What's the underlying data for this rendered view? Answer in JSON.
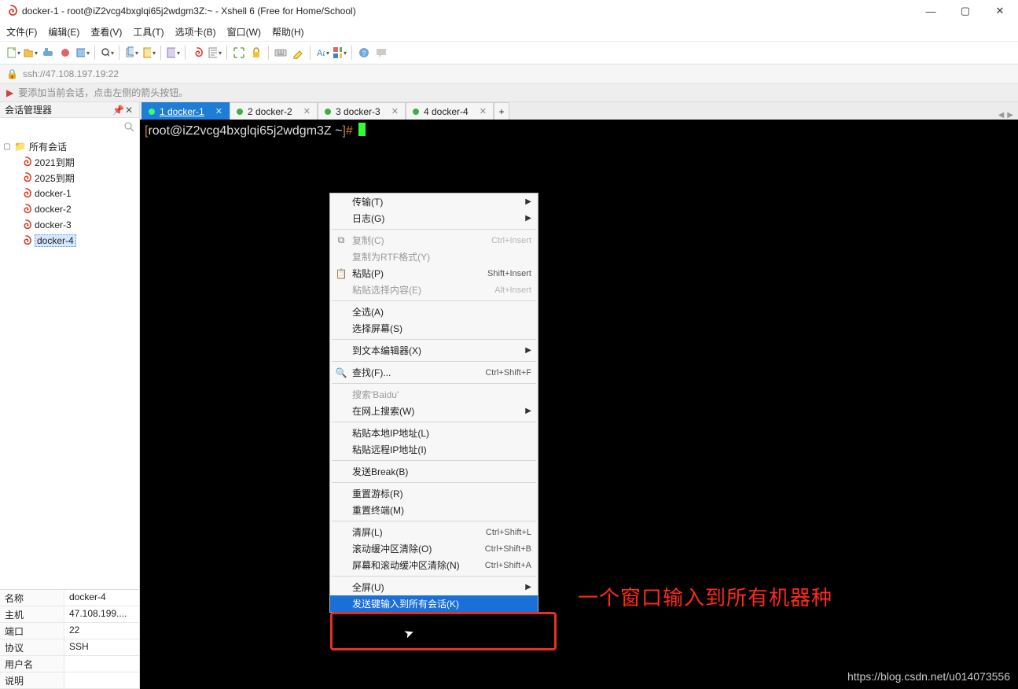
{
  "window": {
    "title": "docker-1 - root@iZ2vcg4bxglqi65j2wdgm3Z:~ - Xshell 6 (Free for Home/School)"
  },
  "menu": {
    "file": "文件(F)",
    "edit": "编辑(E)",
    "view": "查看(V)",
    "tools": "工具(T)",
    "tabs": "选项卡(B)",
    "window": "窗口(W)",
    "help": "帮助(H)"
  },
  "address": {
    "url": "ssh://47.108.197.19:22"
  },
  "hint": {
    "text": "要添加当前会话，点击左侧的箭头按钮。"
  },
  "sidebar": {
    "title": "会话管理器",
    "root": "所有会话",
    "items": [
      {
        "label": "2021到期"
      },
      {
        "label": "2025到期"
      },
      {
        "label": "docker-1"
      },
      {
        "label": "docker-2"
      },
      {
        "label": "docker-3"
      },
      {
        "label": "docker-4"
      }
    ]
  },
  "props": {
    "name_k": "名称",
    "name_v": "docker-4",
    "host_k": "主机",
    "host_v": "47.108.199....",
    "port_k": "端口",
    "port_v": "22",
    "proto_k": "协议",
    "proto_v": "SSH",
    "user_k": "用户名",
    "user_v": "",
    "desc_k": "说明",
    "desc_v": ""
  },
  "tabs": {
    "items": [
      {
        "label": "1 docker-1"
      },
      {
        "label": "2 docker-2"
      },
      {
        "label": "3 docker-3"
      },
      {
        "label": "4 docker-4"
      }
    ],
    "add": "+"
  },
  "terminal": {
    "prompt_open": "[",
    "prompt_user": "root@iZ2vcg4bxglqi65j2wdgm3Z ~",
    "prompt_close": "]#"
  },
  "ctx": {
    "transfer": "传输(T)",
    "log": "日志(G)",
    "copy": "复制(C)",
    "copy_sc": "Ctrl+Insert",
    "copy_rtf": "复制为RTF格式(Y)",
    "paste": "粘贴(P)",
    "paste_sc": "Shift+Insert",
    "paste_sel": "粘贴选择内容(E)",
    "paste_sel_sc": "Alt+Insert",
    "select_all": "全选(A)",
    "select_screen": "选择屏幕(S)",
    "to_editor": "到文本编辑器(X)",
    "find": "查找(F)...",
    "find_sc": "Ctrl+Shift+F",
    "search_baidu": "搜索'Baidu'",
    "web_search": "在网上搜索(W)",
    "paste_local_ip": "粘贴本地IP地址(L)",
    "paste_remote_ip": "粘贴远程IP地址(I)",
    "send_break": "发送Break(B)",
    "reset_cursor": "重置游标(R)",
    "reset_term": "重置终端(M)",
    "clear": "清屏(L)",
    "clear_sc": "Ctrl+Shift+L",
    "clear_scroll": "滚动缓冲区清除(O)",
    "clear_scroll_sc": "Ctrl+Shift+B",
    "clear_all": "屏幕和滚动缓冲区清除(N)",
    "clear_all_sc": "Ctrl+Shift+A",
    "fullscreen": "全屏(U)",
    "send_all": "发送键输入到所有会话(K)"
  },
  "annotation": {
    "text": "一个窗口输入到所有机器种"
  },
  "watermark": "https://blog.csdn.net/u014073556"
}
